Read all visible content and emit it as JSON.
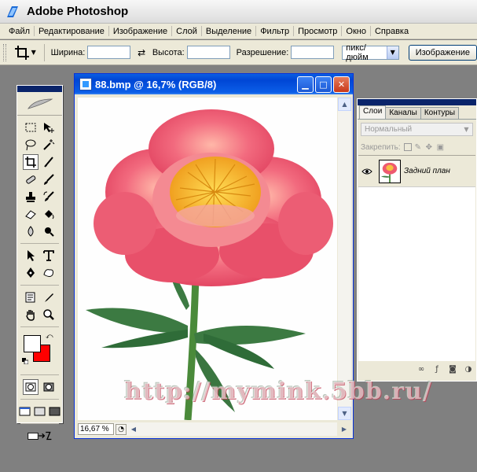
{
  "app": {
    "title": "Adobe Photoshop"
  },
  "menu": {
    "items": [
      "Файл",
      "Редактирование",
      "Изображение",
      "Слой",
      "Выделение",
      "Фильтр",
      "Просмотр",
      "Окно",
      "Справка"
    ]
  },
  "options": {
    "width_label": "Ширина:",
    "width_value": "",
    "height_label": "Высота:",
    "height_value": "",
    "resolution_label": "Разрешение:",
    "resolution_value": "",
    "unit_value": "пикс/дюйм",
    "image_button": "Изображение"
  },
  "document": {
    "title": "88.bmp @ 16,7% (RGB/8)",
    "zoom": "16,67 %"
  },
  "layers_palette": {
    "tabs": [
      "Слои",
      "Каналы",
      "Контуры"
    ],
    "blend_mode": "Нормальный",
    "lock_label": "Закрепить:",
    "layers": [
      {
        "name": "Задний план"
      }
    ]
  },
  "watermark": "http://mymink.5bb.ru/",
  "colors": {
    "foreground": "#ffffff",
    "background": "#ff0000",
    "title_accent": "#0054e3"
  }
}
